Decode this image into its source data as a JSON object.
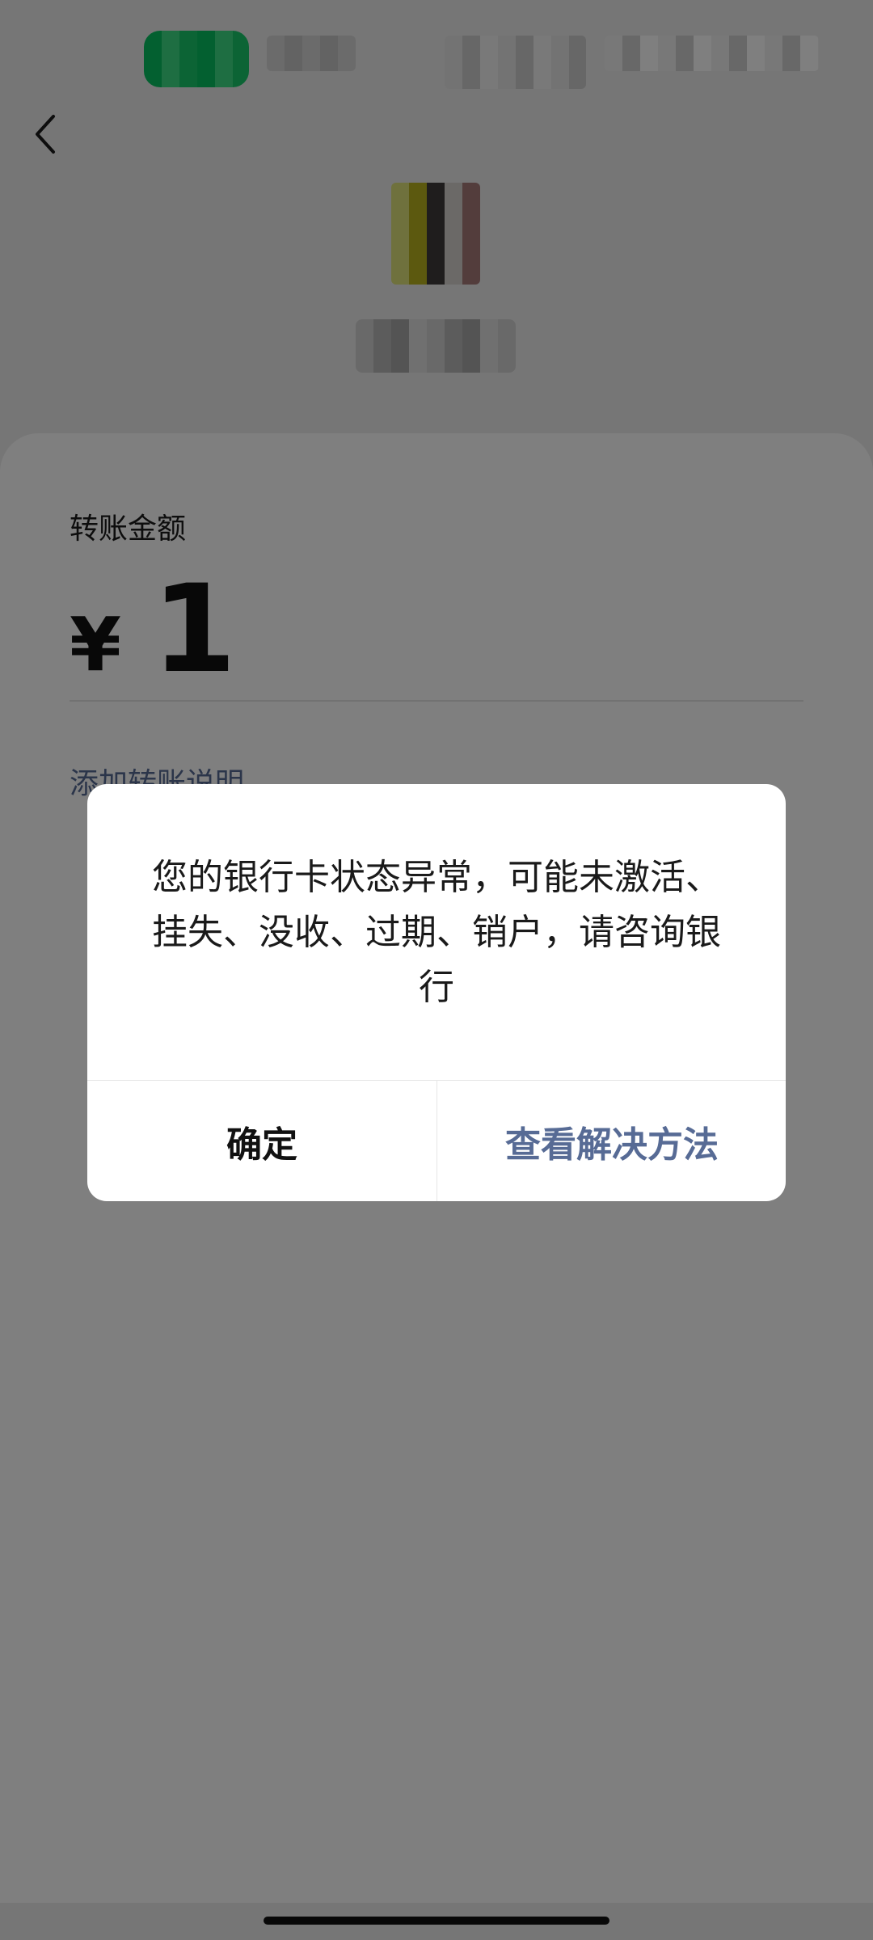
{
  "screen": {
    "back_icon": "chevron-left-icon"
  },
  "transfer": {
    "amount_label": "转账金额",
    "currency_symbol": "¥",
    "amount_value": "1",
    "add_note_link": "添加转账说明"
  },
  "dialog": {
    "message": "您的银行卡状态异常，可能未激活、挂失、没收、过期、销户，请咨询银行",
    "confirm_label": "确定",
    "solution_label": "查看解决方法"
  },
  "colors": {
    "link_blue": "#576b95",
    "overlay": "rgba(0,0,0,0.50)",
    "dialog_bg": "#ffffff"
  }
}
